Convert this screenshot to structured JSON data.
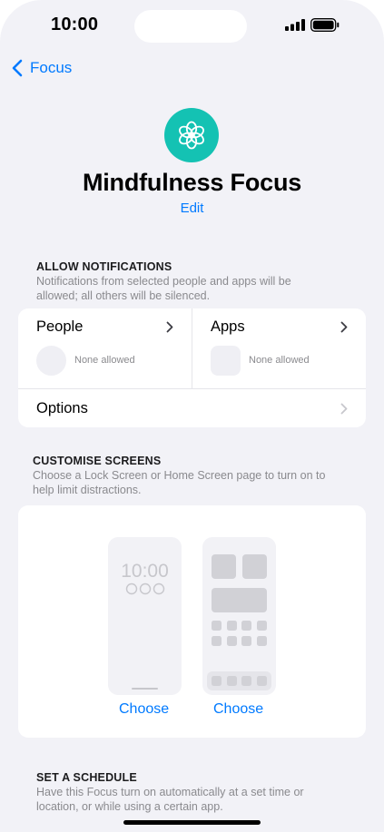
{
  "status_bar": {
    "time": "10:00"
  },
  "nav": {
    "back_label": "Focus"
  },
  "focus": {
    "title": "Mindfulness Focus",
    "edit_label": "Edit",
    "icon": "flower-icon",
    "accent_color": "#14c2b3"
  },
  "allow_notifications": {
    "header": "ALLOW NOTIFICATIONS",
    "subtitle_line1": "Notifications from selected people and apps will be",
    "subtitle_line2": "allowed; all others will be silenced.",
    "people": {
      "label": "People",
      "value": "None allowed"
    },
    "apps": {
      "label": "Apps",
      "value": "None allowed"
    },
    "options_label": "Options"
  },
  "customise_screens": {
    "header": "CUSTOMISE SCREENS",
    "subtitle_line1": "Choose a Lock Screen or Home Screen page to turn on to",
    "subtitle_line2": "help limit distractions.",
    "lock_screen_time": "10:00",
    "lock_choose_label": "Choose",
    "home_choose_label": "Choose"
  },
  "schedule": {
    "header": "SET A SCHEDULE",
    "subtitle_line1": "Have this Focus turn on automatically at a set time or",
    "subtitle_line2": "location, or while using a certain app."
  },
  "colors": {
    "link": "#007aff",
    "background": "#f2f2f7"
  }
}
